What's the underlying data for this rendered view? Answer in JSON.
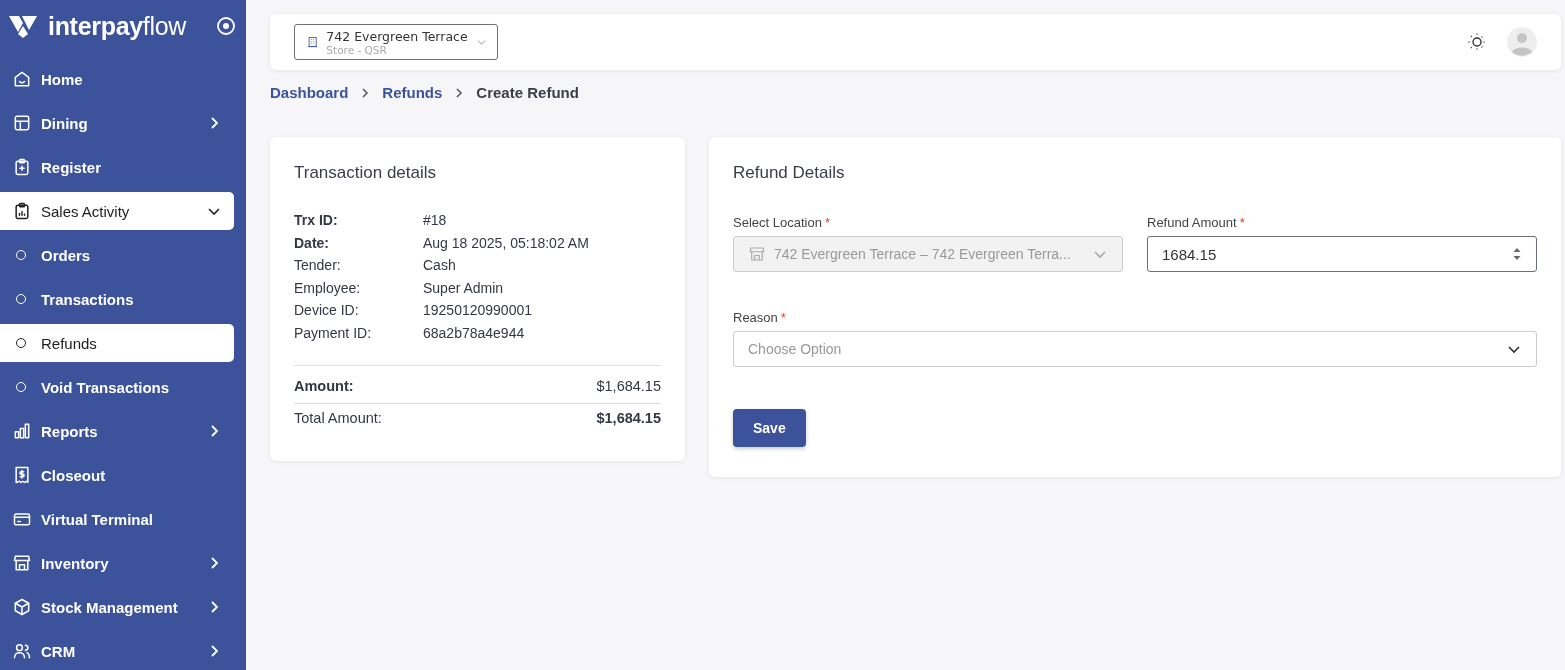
{
  "brand": {
    "name_bold": "interpay",
    "name_light": "flow"
  },
  "nav": [
    {
      "label": "Home",
      "kind": "item",
      "selected": false
    },
    {
      "label": "Dining",
      "kind": "item",
      "selected": false,
      "expanded": false
    },
    {
      "label": "Register",
      "kind": "item",
      "selected": false
    },
    {
      "label": "Sales Activity",
      "kind": "item",
      "selected": true,
      "expanded": true
    },
    {
      "label": "Orders",
      "kind": "sub",
      "selected": false
    },
    {
      "label": "Transactions",
      "kind": "sub",
      "selected": false
    },
    {
      "label": "Refunds",
      "kind": "sub",
      "selected": true
    },
    {
      "label": "Void Transactions",
      "kind": "sub",
      "selected": false
    },
    {
      "label": "Reports",
      "kind": "item",
      "selected": false,
      "expanded": false
    },
    {
      "label": "Closeout",
      "kind": "item",
      "selected": false
    },
    {
      "label": "Virtual Terminal",
      "kind": "item",
      "selected": false
    },
    {
      "label": "Inventory",
      "kind": "item",
      "selected": false,
      "expanded": false
    },
    {
      "label": "Stock Management",
      "kind": "item",
      "selected": false,
      "expanded": false
    },
    {
      "label": "CRM",
      "kind": "item",
      "selected": false,
      "expanded": false
    }
  ],
  "store_selector": {
    "name": "742 Evergreen Terrace",
    "type": "Store - QSR"
  },
  "breadcrumb": [
    {
      "label": "Dashboard",
      "current": false
    },
    {
      "label": "Refunds",
      "current": false
    },
    {
      "label": "Create Refund",
      "current": true
    }
  ],
  "transaction": {
    "title": "Transaction details",
    "rows": [
      {
        "label": "Trx ID:",
        "value": "#18",
        "bold": true
      },
      {
        "label": "Date:",
        "value": "Aug 18 2025, 05:18:02 AM",
        "bold": true
      },
      {
        "label": "Tender:",
        "value": "Cash",
        "bold": false
      },
      {
        "label": "Employee:",
        "value": "Super Admin",
        "bold": false
      },
      {
        "label": "Device ID:",
        "value": "19250120990001",
        "bold": false
      },
      {
        "label": "Payment ID:",
        "value": "68a2b78a4e944",
        "bold": false
      }
    ],
    "amount": {
      "label": "Amount:",
      "value": "$1,684.15"
    },
    "total": {
      "label": "Total Amount:",
      "value": "$1,684.15"
    }
  },
  "refund": {
    "title": "Refund Details",
    "location": {
      "label": "Select Location",
      "required": "*",
      "value": "742 Evergreen Terrace – 742 Evergreen Terra...",
      "disabled": true
    },
    "amount": {
      "label": "Refund Amount",
      "required": "*",
      "value": "1684.15"
    },
    "reason": {
      "label": "Reason",
      "required": "*",
      "placeholder": "Choose Option"
    },
    "save": "Save"
  }
}
